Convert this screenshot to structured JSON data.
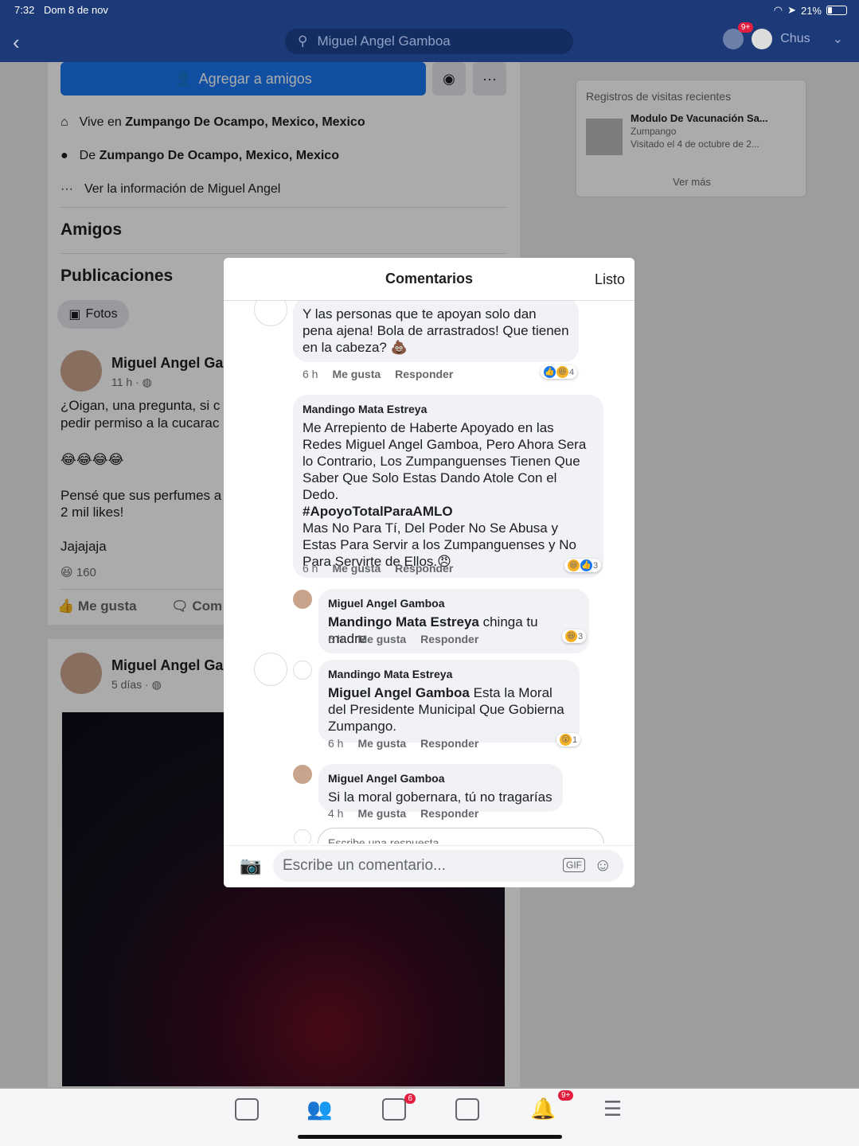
{
  "status": {
    "time": "7:32",
    "date": "Dom 8 de nov",
    "battery": "21%"
  },
  "topbar": {
    "search_text": "Miguel Angel Gamboa",
    "user": "Chus",
    "messenger_badge": "9+"
  },
  "profile": {
    "add_friend": "Agregar a amigos",
    "lives_prefix": "Vive en",
    "lives": "Zumpango De Ocampo, Mexico, Mexico",
    "from_prefix": "De",
    "from": "Zumpango De Ocampo, Mexico, Mexico",
    "see_info": "Ver la información de Miguel Angel",
    "friends_title": "Amigos",
    "posts_title": "Publicaciones",
    "photos_chip": "Fotos"
  },
  "post1": {
    "author": "Miguel Angel Gar",
    "time": "11 h · ",
    "line1": "¿Oigan, una pregunta, si c",
    "line2": "pedir permiso a la cucarac",
    "emojis": "😂😂😂😂",
    "line3": "Pensé que sus perfumes a",
    "line4": "2 mil likes!",
    "line5": "Jajajaja",
    "reactions": "160",
    "like": "Me gusta",
    "comment": "Com"
  },
  "post2": {
    "author": "Miguel Angel Gar",
    "time": "5 días · "
  },
  "recent": {
    "title": "Registros de visitas recientes",
    "item_name": "Modulo De Vacunación Sa...",
    "item_place": "Zumpango",
    "item_visited": "Visitado el 4 de octubre de 2...",
    "see_more": "Ver más"
  },
  "nav": {
    "video_badge": "6",
    "notif_badge": "9+"
  },
  "modal": {
    "title": "Comentarios",
    "done": "Listo",
    "comments": [
      {
        "author": "",
        "text": "Y las personas que te apoyan solo dan pena ajena! Bola de arrastrados! Que tienen en la cabeza? 💩",
        "time": "6 h",
        "like": "Me gusta",
        "reply": "Responder",
        "reacts": "4"
      },
      {
        "author": "Mandingo Mata Estreya",
        "text1": "Me Arrepiento de Haberte Apoyado en las Redes Miguel Angel Gamboa, Pero Ahora Sera lo Contrario, Los Zumpanguenses Tienen Que Saber Que Solo Estas Dando Atole Con el Dedo.",
        "hashtag": "#ApoyoTotalParaAMLO",
        "text2": "Mas No Para Tí, Del Poder No Se Abusa y Estas Para Servir a los Zumpanguenses y No Para Servirte de Ellos.😠",
        "time": "6 h",
        "like": "Me gusta",
        "reply": "Responder",
        "reacts": "3"
      },
      {
        "author": "Miguel Angel Gamboa",
        "mention": "Mandingo Mata Estreya",
        "text": " chinga tu madre",
        "time": "6 h",
        "like": "Me gusta",
        "reply": "Responder",
        "reacts": "3"
      },
      {
        "author": "Mandingo Mata Estreya",
        "mention": "Miguel Angel Gamboa",
        "text": " Esta la Moral del Presidente Municipal Que Gobierna Zumpango.",
        "time": "6 h",
        "like": "Me gusta",
        "reply": "Responder",
        "reacts": "1"
      },
      {
        "author": "Miguel Angel Gamboa",
        "text": "Si la moral gobernara, tú no tragarías",
        "time": "4 h",
        "like": "Me gusta",
        "reply": "Responder"
      }
    ],
    "reply_placeholder": "Escribe una respuesta...",
    "comment_placeholder": "Escribe un comentario...",
    "gif": "GIF"
  }
}
